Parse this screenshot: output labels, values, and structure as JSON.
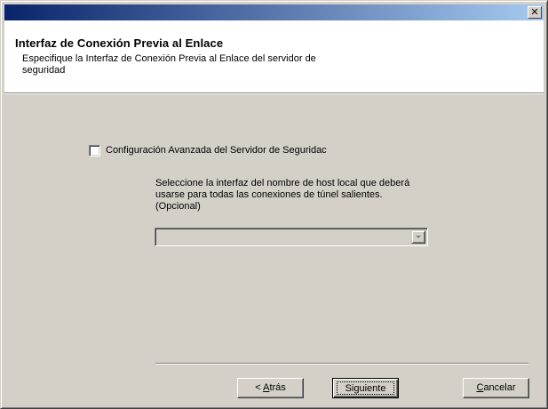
{
  "titlebar": {
    "close_glyph": "✕"
  },
  "header": {
    "title": "Interfaz de Conexión Previa al Enlace",
    "subtitle": "Especifique la Interfaz de Conexión Previa al Enlace del servidor de seguridad"
  },
  "options": {
    "advanced_checkbox": {
      "label": "Configuración Avanzada del Servidor de Seguridac",
      "checked": false
    },
    "description": "Seleccione la interfaz del nombre de host local que deberá usarse para todas las conexiones de túnel salientes. (Opcional)",
    "interface_select": {
      "value": "",
      "enabled": false
    }
  },
  "buttons": {
    "back": {
      "prefix": "< ",
      "mnemonic": "A",
      "rest": "trás"
    },
    "next": "Siguiente",
    "cancel": {
      "mnemonic": "C",
      "rest": "ancelar"
    }
  },
  "colors": {
    "title_gradient_start": "#0a246a",
    "title_gradient_end": "#a6caf0",
    "face": "#d4d0c8"
  }
}
